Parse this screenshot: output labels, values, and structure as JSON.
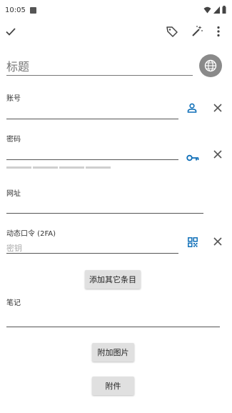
{
  "status_bar": {
    "time": "10:05"
  },
  "toolbar": {
    "confirm_icon": "check-icon",
    "tag_icon": "tag-icon",
    "magic_icon": "magic-wand-icon",
    "more_icon": "more-vert-icon"
  },
  "title_field": {
    "placeholder": "标题",
    "value": ""
  },
  "fields": {
    "account": {
      "label": "账号",
      "value": ""
    },
    "password": {
      "label": "密码",
      "value": ""
    },
    "website": {
      "label": "网址",
      "value": ""
    },
    "otp": {
      "label": "动态口令 (2FA)",
      "placeholder": "密钥"
    },
    "notes": {
      "label": "笔记",
      "value": ""
    }
  },
  "buttons": {
    "add_other": "添加其它条目",
    "attach_image": "附加图片",
    "attachment": "附件"
  },
  "colors": {
    "accent": "#0f6fb8",
    "icon_gray": "#555555"
  }
}
